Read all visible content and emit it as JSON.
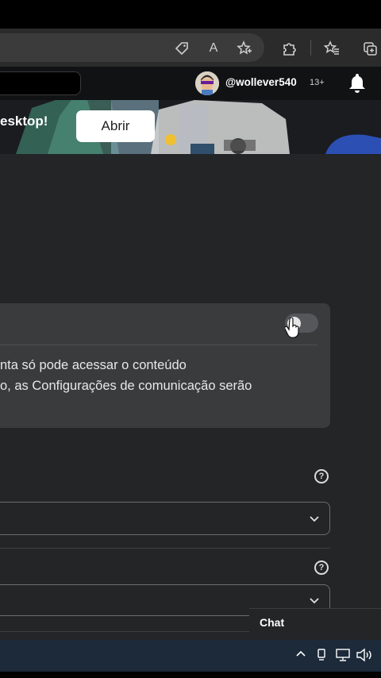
{
  "browser": {
    "icons": [
      "tag-icon",
      "read-aloud-icon",
      "favorite-add-icon",
      "extensions-icon",
      "favorites-icon",
      "collections-icon"
    ],
    "read_aloud_text": "A"
  },
  "header": {
    "username": "@wollever540",
    "age_badge": "13+"
  },
  "banner": {
    "text": "esktop!",
    "open_button": "Abrir"
  },
  "settings": {
    "toggle_on": false,
    "description_line1": "nta só pode acessar o conteúdo",
    "description_line2": "o, as Configurações de comunicação serão"
  },
  "help_mark": "?",
  "chat": {
    "label": "Chat"
  },
  "taskbar": {
    "tray_icons": [
      "chevron-up-icon",
      "pen-icon",
      "network-icon",
      "speaker-icon"
    ]
  },
  "colors": {
    "content_bg": "#232527",
    "card_bg": "#393b3d",
    "header_bg": "#111214",
    "taskbar_bg": "#1c2a3a"
  }
}
